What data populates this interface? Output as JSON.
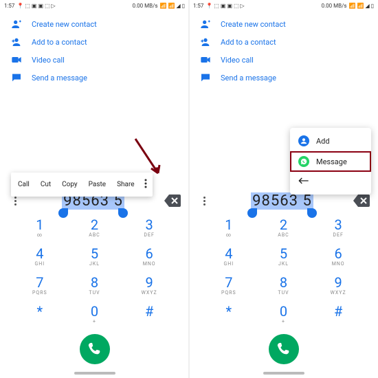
{
  "status": {
    "time": "1:57",
    "net": "0.00 MB/s"
  },
  "actions": {
    "create": "Create new contact",
    "add": "Add to a contact",
    "video": "Video call",
    "send": "Send a message"
  },
  "sel_menu": {
    "call": "Call",
    "cut": "Cut",
    "copy": "Copy",
    "paste": "Paste",
    "share": "Share"
  },
  "ext_menu": {
    "add": "Add",
    "message": "Message"
  },
  "dialed": {
    "selected": "98563 5"
  },
  "keys": {
    "k1": {
      "d": "1",
      "s": "∞"
    },
    "k2": {
      "d": "2",
      "s": "ABC"
    },
    "k3": {
      "d": "3",
      "s": "DEF"
    },
    "k4": {
      "d": "4",
      "s": "GHI"
    },
    "k5": {
      "d": "5",
      "s": "JKL"
    },
    "k6": {
      "d": "6",
      "s": "MNO"
    },
    "k7": {
      "d": "7",
      "s": "PQRS"
    },
    "k8": {
      "d": "8",
      "s": "TUV"
    },
    "k9": {
      "d": "9",
      "s": "WXYZ"
    },
    "kstar": {
      "d": "*",
      "s": ""
    },
    "k0": {
      "d": "0",
      "s": "+"
    },
    "khash": {
      "d": "#",
      "s": ""
    }
  },
  "colors": {
    "link": "#1a73e8",
    "call": "#00a861",
    "wa": "#25d366"
  }
}
